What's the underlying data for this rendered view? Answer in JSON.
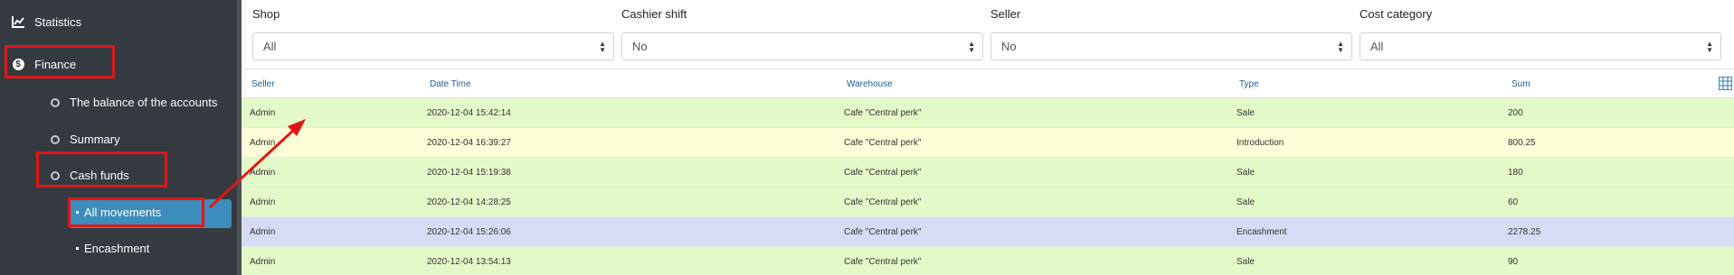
{
  "sidebar": {
    "statistics": "Statistics",
    "finance": "Finance",
    "balance": "The balance of the accounts",
    "summary": "Summary",
    "cash_funds": "Cash funds",
    "all_movements": "All movements",
    "encashment": "Encashment"
  },
  "filters": {
    "shop": {
      "label": "Shop",
      "value": "All"
    },
    "cashier_shift": {
      "label": "Cashier shift",
      "value": "No"
    },
    "seller": {
      "label": "Seller",
      "value": "No"
    },
    "cost_category": {
      "label": "Cost category",
      "value": "All"
    }
  },
  "table": {
    "headers": [
      "Seller",
      "Date Time",
      "Warehouse",
      "Type",
      "Sum"
    ],
    "rows": [
      {
        "seller": "Admin",
        "datetime": "2020-12-04 15:42:14",
        "warehouse": "Cafe \"Central perk\"",
        "type": "Sale",
        "sum": "200",
        "color": "#e4f9c8"
      },
      {
        "seller": "Admin",
        "datetime": "2020-12-04 16:39:27",
        "warehouse": "Cafe \"Central perk\"",
        "type": "Introduction",
        "sum": "800.25",
        "color": "#fdfdd8"
      },
      {
        "seller": "Admin",
        "datetime": "2020-12-04 15:19:38",
        "warehouse": "Cafe \"Central perk\"",
        "type": "Sale",
        "sum": "180",
        "color": "#e4f9c8"
      },
      {
        "seller": "Admin",
        "datetime": "2020-12-04 14:28:25",
        "warehouse": "Cafe \"Central perk\"",
        "type": "Sale",
        "sum": "60",
        "color": "#e4f9c8"
      },
      {
        "seller": "Admin",
        "datetime": "2020-12-04 15:26:06",
        "warehouse": "Cafe \"Central perk\"",
        "type": "Encashment",
        "sum": "2278.25",
        "color": "#d5dcf3"
      },
      {
        "seller": "Admin",
        "datetime": "2020-12-04 13:54:13",
        "warehouse": "Cafe \"Central perk\"",
        "type": "Sale",
        "sum": "90",
        "color": "#e4f9c8"
      }
    ]
  },
  "colors": {
    "sidebar_bg": "#343a40",
    "active_item": "#3c8dbc",
    "annotation_red": "#e01616",
    "header_text": "#1e5a96"
  },
  "icons": {
    "statistics": "chart-line-icon",
    "finance": "dollar-circle-icon",
    "columns": "table-grid-icon"
  }
}
